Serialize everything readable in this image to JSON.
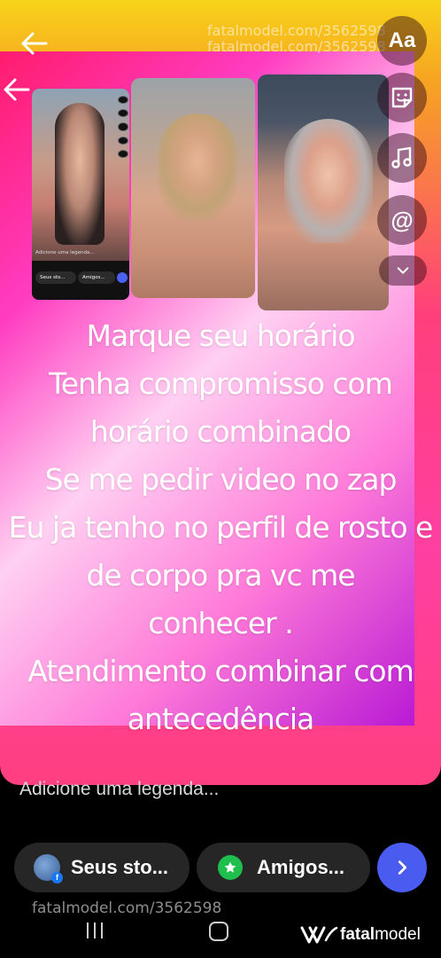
{
  "watermark": {
    "top_line1": "fatalmodel.com/3562598",
    "top_line2": "fatalmodel.com/3562598",
    "bottom": "fatalmodel.com/3562598"
  },
  "tools": {
    "text_label": "Aa",
    "mention_label": "@"
  },
  "inner_screenshot": {
    "caption": "Adicione uma legenda...",
    "story_pill": "Seus sto...",
    "friends_pill": "Amigos..."
  },
  "story_text": {
    "lines": [
      "Marque seu horário",
      "Tenha compromisso com",
      "horário combinado",
      "Se me pedir video no zap",
      "Eu ja tenho no perfil de rosto e",
      "de corpo  pra vc me",
      "conhecer .",
      "Atendimento combinar com",
      "antecedência"
    ]
  },
  "caption_input": {
    "placeholder": "Adicione uma legenda..."
  },
  "share": {
    "story_label": "Seus sto...",
    "friends_label": "Amigos..."
  },
  "brand": {
    "name_part1": "fatal",
    "name_part2": "model"
  },
  "colors": {
    "send_button": "#4a5cf0",
    "friends_star": "#1fbf4e",
    "pill_bg": "#262626"
  }
}
